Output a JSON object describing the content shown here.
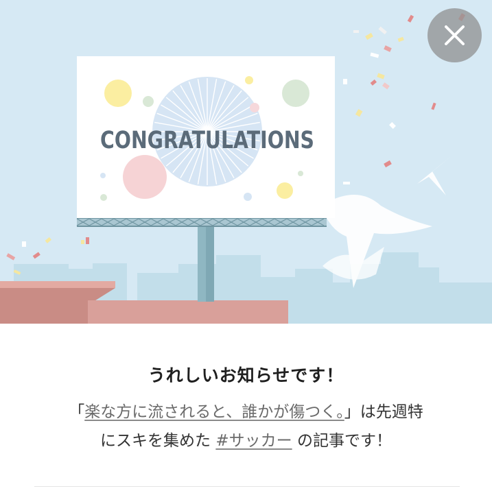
{
  "modal": {
    "billboard_text": "CONGRATULATIONS",
    "headline": "うれしいお知らせです！",
    "message": {
      "prefix": "「",
      "article_title": "楽な方に流されると、誰かが傷つく。",
      "mid": "」は先週特",
      "line2_prefix": "にスキを集めた",
      "hashtag": "#サッカー",
      "suffix": "の記事です！"
    },
    "close_icon": "close-icon"
  },
  "colors": {
    "sky": "#d5e8f3",
    "city": "#bfdde9",
    "roof": "#d59c95",
    "billboard_pole": "#8fb7c2",
    "billboard_text": "#5b6b79",
    "close_bg": "#8c8c8c"
  }
}
